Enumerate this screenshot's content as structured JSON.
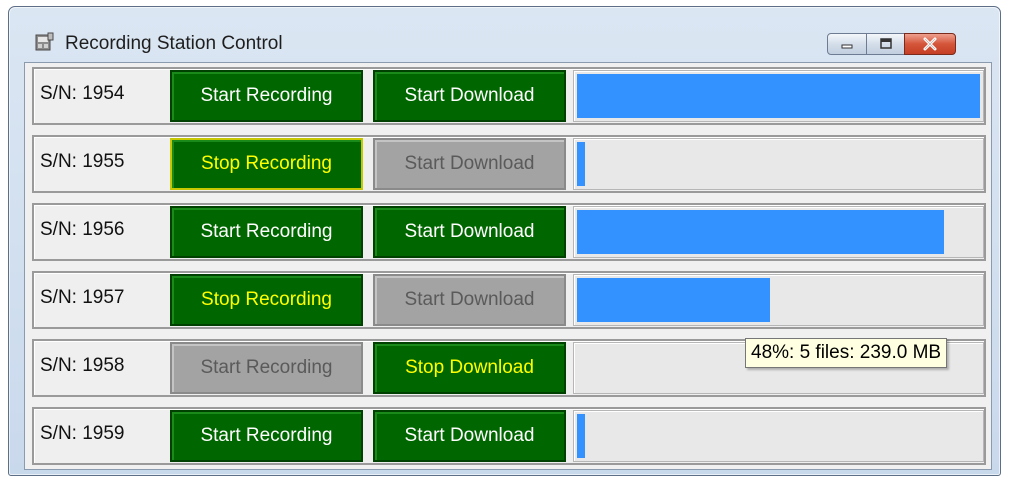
{
  "window": {
    "title": "Recording Station Control",
    "icons": {
      "app": "recorder-app-icon",
      "minimize": "minimize-icon",
      "maximize": "maximize-icon",
      "close": "close-icon"
    }
  },
  "colors": {
    "button_green": "#006600",
    "button_active_text": "#ffff00",
    "button_disabled": "#a3a3a3",
    "progress_fill": "#3392ff",
    "tooltip_bg": "#ffffe1"
  },
  "stations": [
    {
      "serial": "S/N: 1954",
      "record_label": "Start Recording",
      "record_state": "normal",
      "download_label": "Start Download",
      "download_state": "normal",
      "progress": 1.0
    },
    {
      "serial": "S/N: 1955",
      "record_label": "Stop Recording",
      "record_state": "active-focused",
      "download_label": "Start Download",
      "download_state": "disabled",
      "progress": 0.02
    },
    {
      "serial": "S/N: 1956",
      "record_label": "Start Recording",
      "record_state": "normal",
      "download_label": "Start Download",
      "download_state": "normal",
      "progress": 0.91
    },
    {
      "serial": "S/N: 1957",
      "record_label": "Stop Recording",
      "record_state": "active",
      "download_label": "Start Download",
      "download_state": "disabled",
      "progress": 0.48
    },
    {
      "serial": "S/N: 1958",
      "record_label": "Start Recording",
      "record_state": "disabled",
      "download_label": "Stop Download",
      "download_state": "active",
      "progress": 0.0
    },
    {
      "serial": "S/N: 1959",
      "record_label": "Start Recording",
      "record_state": "normal",
      "download_label": "Start Download",
      "download_state": "normal",
      "progress": 0.02
    }
  ],
  "tooltip": {
    "text": "48%: 5 files: 239.0 MB"
  }
}
